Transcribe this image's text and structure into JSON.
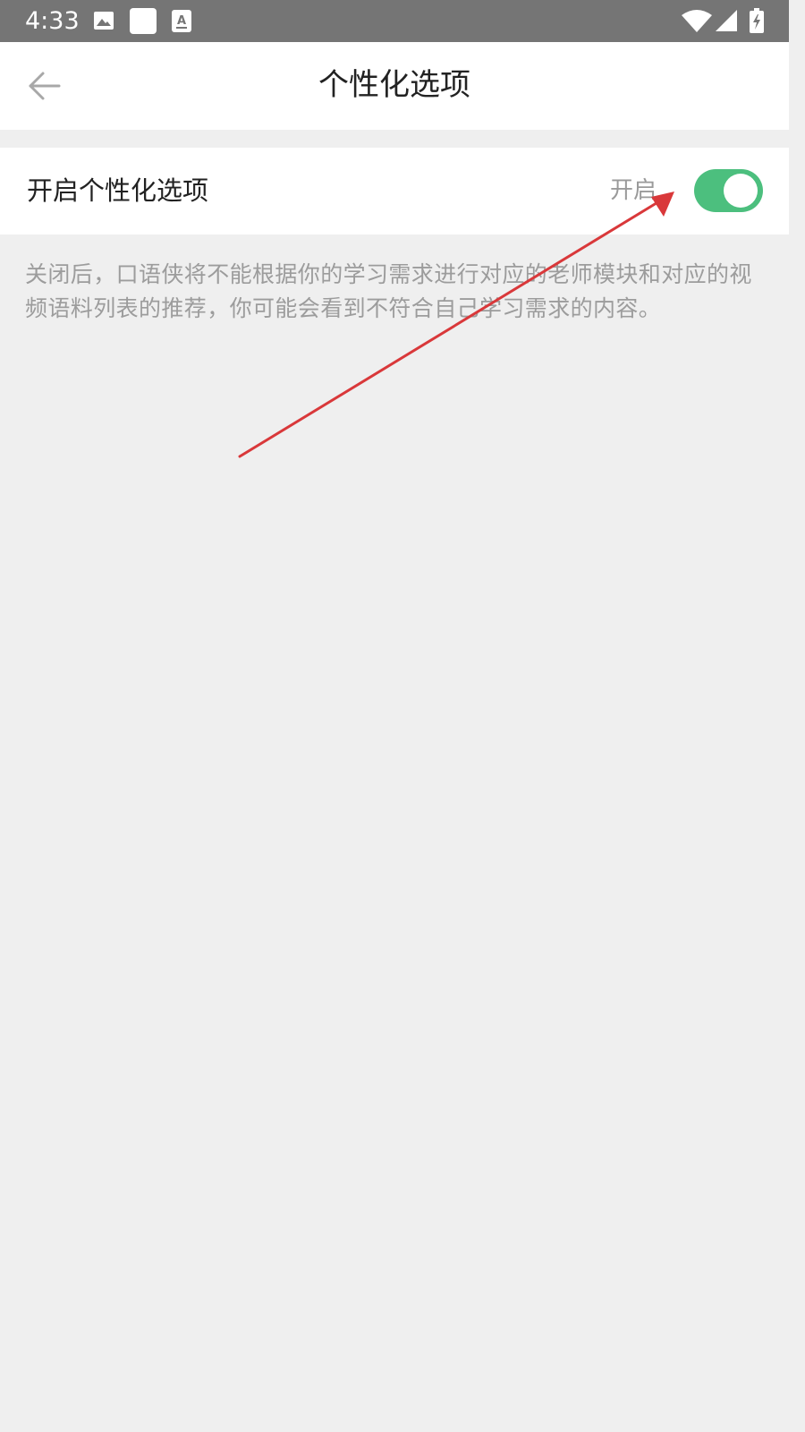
{
  "status_bar": {
    "time": "4:33",
    "icons": [
      "image-icon",
      "blank-square-icon",
      "text-a-icon",
      "wifi-icon",
      "signal-icon",
      "battery-charging-icon"
    ]
  },
  "app_bar": {
    "title": "个性化选项",
    "back_icon": "arrow-left-icon"
  },
  "setting": {
    "label": "开启个性化选项",
    "status_text": "开启",
    "toggle_on": true,
    "toggle_color": "#4cbf7e"
  },
  "description": "关闭后，口语侠将不能根据你的学习需求进行对应的老师模块和对应的视频语料列表的推荐，你可能会看到不符合自己学习需求的内容。",
  "colors": {
    "status_bar_bg": "#757575",
    "background": "#efefef",
    "annotation_arrow": "#d9383a"
  }
}
